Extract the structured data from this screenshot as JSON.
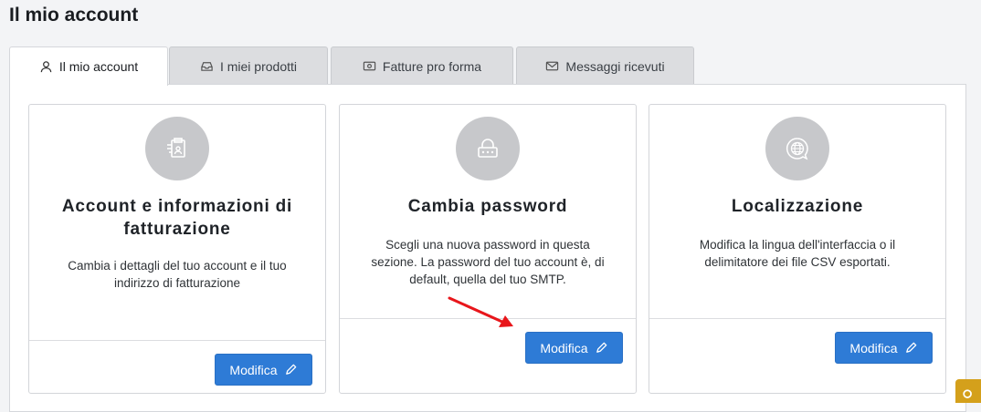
{
  "page": {
    "title": "Il mio account"
  },
  "tabs": [
    {
      "label": "Il mio account",
      "icon": "user-icon",
      "active": true
    },
    {
      "label": "I miei prodotti",
      "icon": "inbox-icon",
      "active": false
    },
    {
      "label": "Fatture pro forma",
      "icon": "money-icon",
      "active": false
    },
    {
      "label": "Messaggi ricevuti",
      "icon": "envelope-icon",
      "active": false
    }
  ],
  "cards": [
    {
      "icon": "billing-document-icon",
      "title": "Account e informazioni di fatturazione",
      "description": "Cambia i dettagli del tuo account e il tuo indirizzo di fatturazione",
      "button": "Modifica"
    },
    {
      "icon": "password-lock-icon",
      "title": "Cambia password",
      "description": "Scegli una nuova password in questa sezione. La password del tuo account è, di default, quella del tuo SMTP.",
      "button": "Modifica"
    },
    {
      "icon": "globe-chat-icon",
      "title": "Localizzazione",
      "description": "Modifica la lingua dell'interfaccia o il delimitatore dei file CSV esportati.",
      "button": "Modifica"
    }
  ],
  "colors": {
    "accent": "#2e7bd6",
    "annotation": "#e8161b",
    "widget": "#d4a01b"
  }
}
